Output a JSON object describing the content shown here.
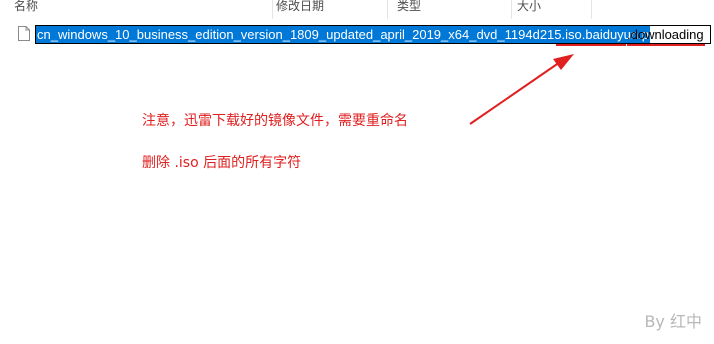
{
  "columns": [
    {
      "label": "名称"
    },
    {
      "label": "修改日期"
    },
    {
      "label": "类型"
    },
    {
      "label": "大小"
    }
  ],
  "file": {
    "selected_text": "cn_windows_10_business_edition_version_1809_updated_april_2019_x64_dvd_1194d215.iso.baiduyun.p",
    "unselected_text": ".downloading",
    "icon": "file-icon"
  },
  "annotation": {
    "line1": "注意，迅雷下载好的镜像文件，需要重命名",
    "line2": "删除 .iso 后面的所有字符",
    "color": "#e02020"
  },
  "watermark": "By 红中"
}
